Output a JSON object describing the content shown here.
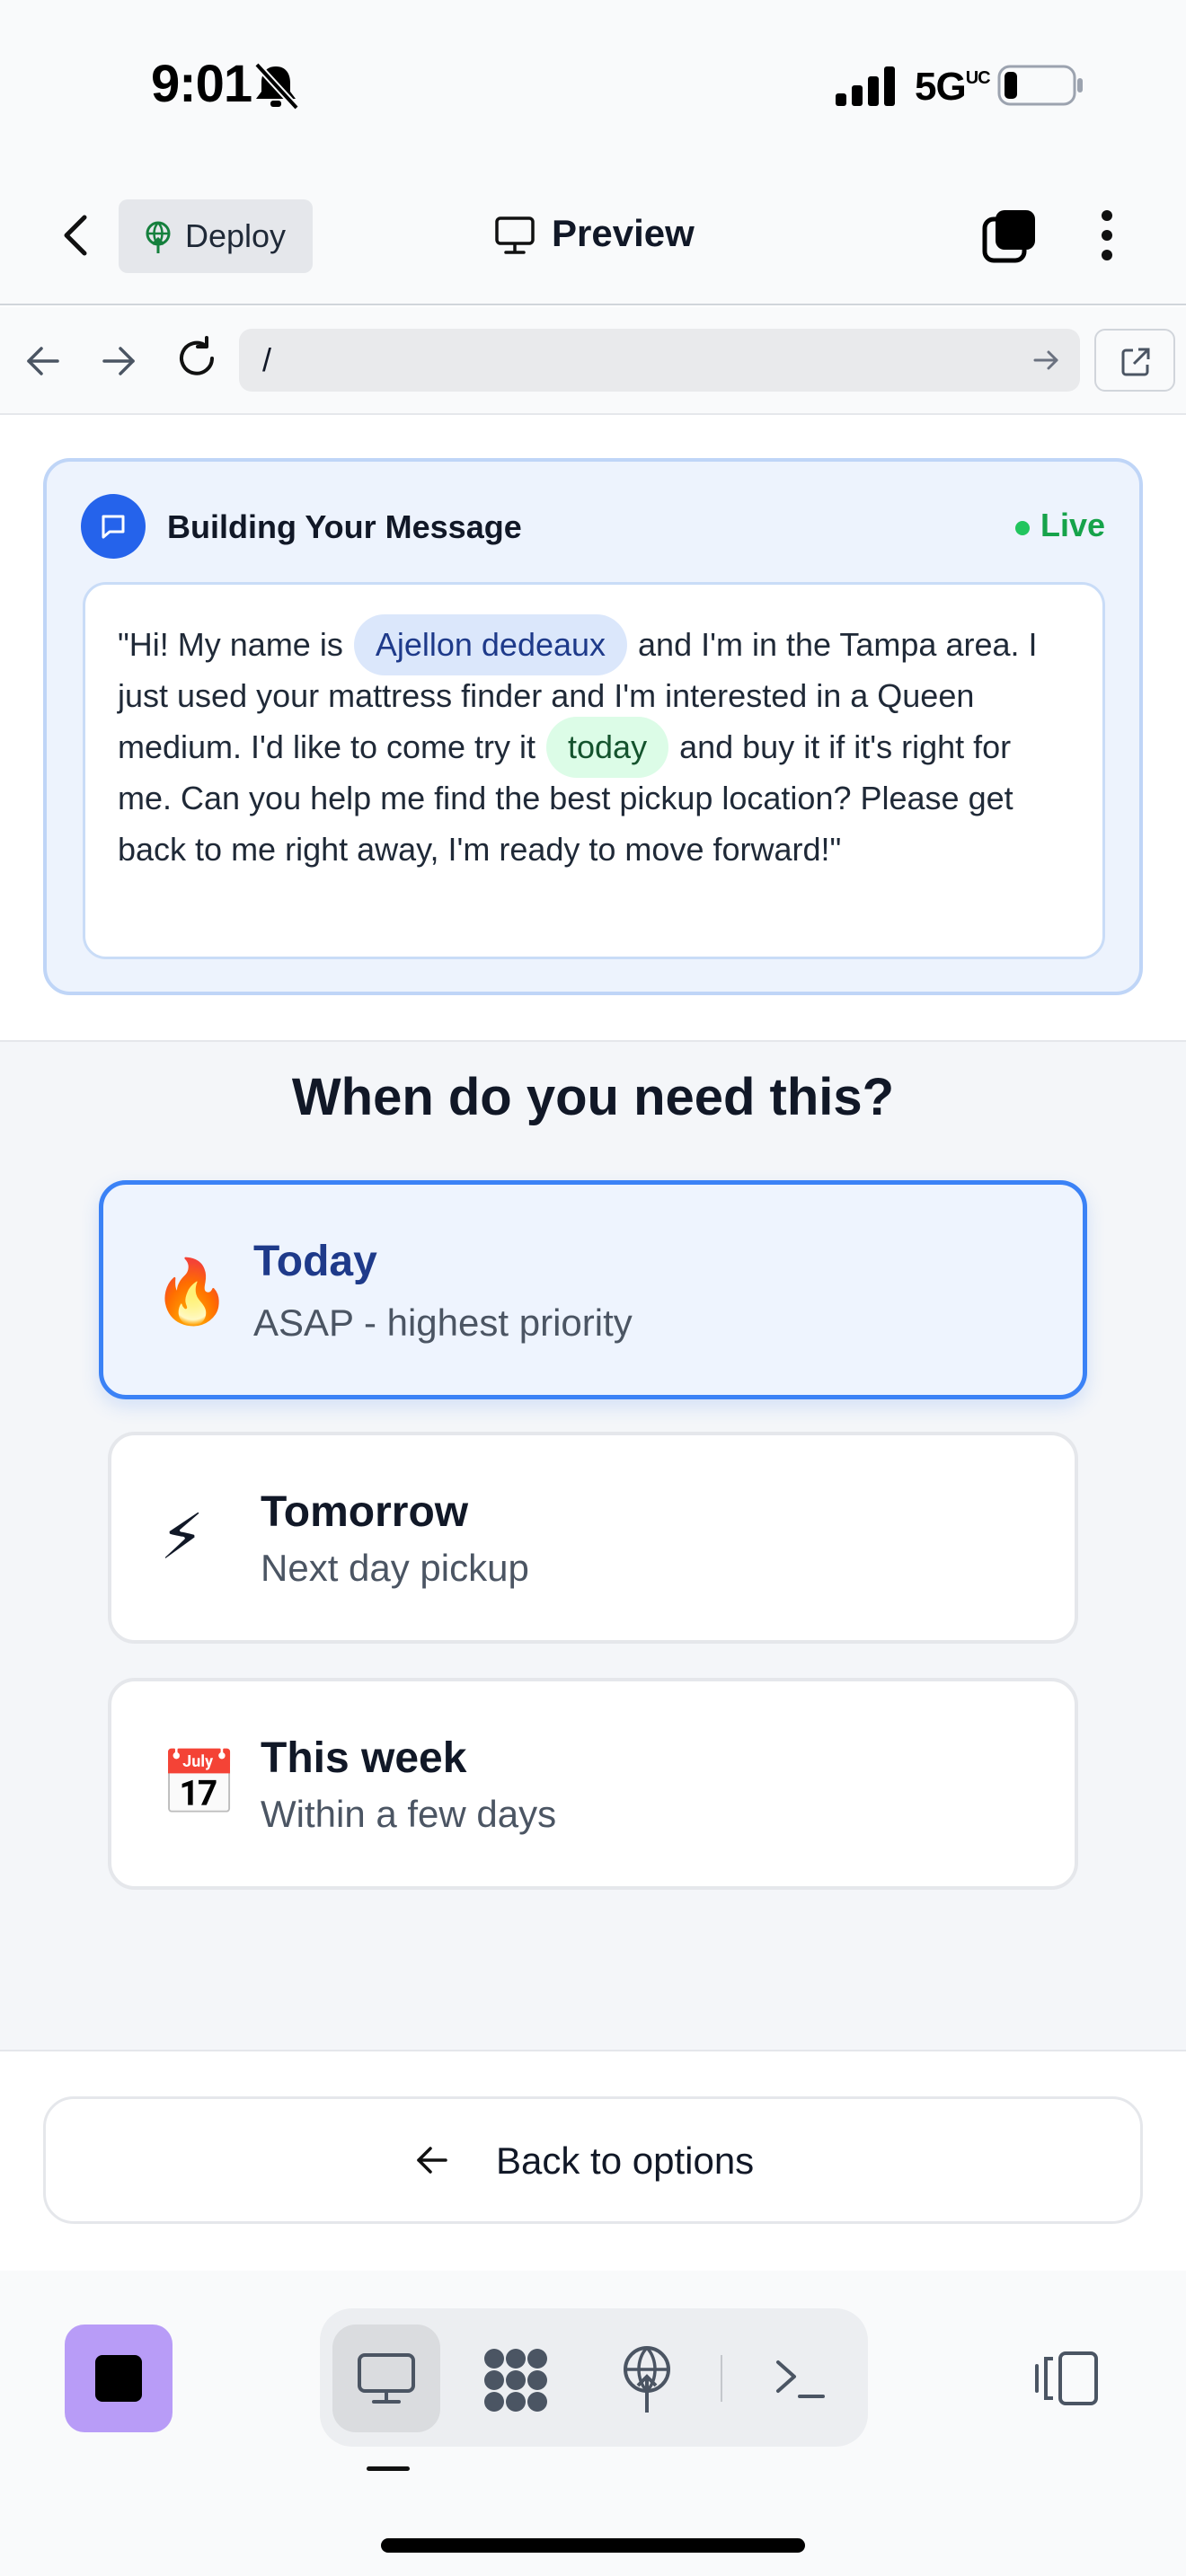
{
  "status_bar": {
    "time": "9:01",
    "network": "5G",
    "network_sup": "UC"
  },
  "header": {
    "deploy_label": "Deploy",
    "title": "Preview"
  },
  "url_bar": {
    "url": "/"
  },
  "message_card": {
    "title": "Building Your Message",
    "status": "Live",
    "text_before_name": "\"Hi! My name is ",
    "name": "Ajellon dedeaux",
    "text_after_name": " and I'm in the Tampa area. I just used your mattress finder and I'm interested in a Queen medium. I'd like to come try it ",
    "when": "today",
    "text_after_when": " and buy it if it's right for me. Can you help me find the best pickup location? Please get back to me right away, I'm ready to move forward!\""
  },
  "question": {
    "title": "When do you need this?",
    "options": [
      {
        "icon": "fire-icon",
        "emoji": "🔥",
        "title": "Today",
        "subtitle": "ASAP - highest priority",
        "selected": true
      },
      {
        "icon": "lightning-icon",
        "emoji": "⚡",
        "title": "Tomorrow",
        "subtitle": "Next day pickup",
        "selected": false
      },
      {
        "icon": "calendar-icon",
        "emoji": "📅",
        "title": "This week",
        "subtitle": "Within a few days",
        "selected": false
      }
    ]
  },
  "back_button": {
    "label": "Back to options"
  },
  "colors": {
    "accent": "#3b82f6",
    "live": "#16a34a",
    "stop": "#b89cf7"
  }
}
